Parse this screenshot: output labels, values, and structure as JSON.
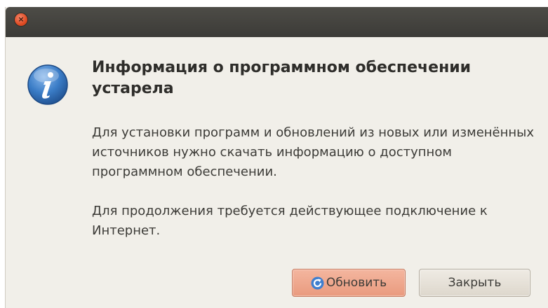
{
  "window": {
    "close_glyph": "×"
  },
  "dialog": {
    "title": "Информация о программном обеспечении устарела",
    "paragraph1": "Для установки программ и обновлений из новых или изменённых источников нужно скачать информацию о доступном программном обеспечении.",
    "paragraph2": "Для продолжения требуется действующее подключение к Интернет.",
    "icon": "info-icon"
  },
  "buttons": {
    "refresh_label": "Обновить",
    "refresh_icon": "refresh-icon",
    "close_label": "Закрыть"
  },
  "colors": {
    "titlebar": "#3c3b37",
    "background": "#f1efe9",
    "info_icon": "#2f6eb5",
    "refresh_button": "#e99a7e"
  }
}
